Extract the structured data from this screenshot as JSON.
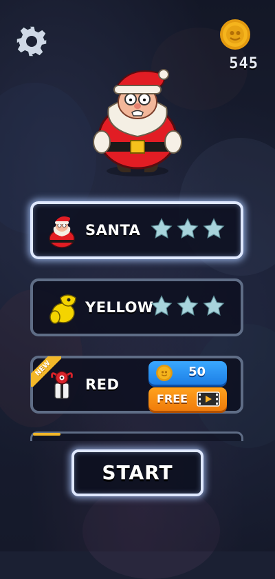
{
  "coins": {
    "count": "545"
  },
  "characters": [
    {
      "name": "SANTA",
      "stars": 3,
      "selected": true,
      "locked": false
    },
    {
      "name": "YELLOW",
      "stars": 3,
      "selected": false,
      "locked": false
    },
    {
      "name": "RED",
      "badge": "NEW",
      "price": "50",
      "free_label": "FREE",
      "locked": true
    }
  ],
  "start": {
    "label": "START"
  },
  "colors": {
    "star": "#a8d4dc",
    "coin_gold": "#f5b41d",
    "coin_button": "#2a92f2",
    "free_button": "#f88f14",
    "new_badge": "#f3b829",
    "card_glow": "#dfe8ff"
  }
}
